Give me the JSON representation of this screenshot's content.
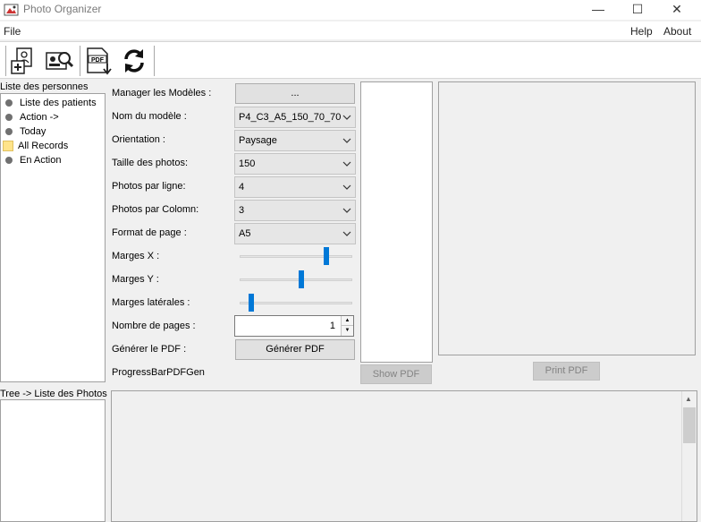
{
  "window": {
    "title": "Photo Organizer",
    "minimize_glyph": "—",
    "maximize_glyph": "☐",
    "close_glyph": "✕"
  },
  "menu": {
    "file": "File",
    "help": "Help",
    "about": "About"
  },
  "toolbar": {
    "buttons": [
      {
        "name": "add-record-icon"
      },
      {
        "name": "search-record-icon"
      },
      {
        "name": "pdf-export-icon",
        "label": "PDF"
      },
      {
        "name": "refresh-icon"
      }
    ]
  },
  "left_panel": {
    "persons_title": "Liste des personnes",
    "tree_items": [
      {
        "label": "Liste des patients",
        "icon": "bullet"
      },
      {
        "label": "Action  ->",
        "icon": "bullet"
      },
      {
        "label": "Today",
        "icon": "bullet"
      },
      {
        "label": "All Records",
        "icon": "folder"
      },
      {
        "label": "En Action",
        "icon": "bullet"
      }
    ],
    "photos_title": "Tree -> Liste des Photos"
  },
  "form": {
    "manager_label": "Manager les Modèles :",
    "manager_button": "...",
    "model_label": "Nom du modèle :",
    "model_value": "P4_C3_A5_150_70_70",
    "orientation_label": "Orientation :",
    "orientation_value": "Paysage",
    "photo_size_label": "Taille des photos:",
    "photo_size_value": "150",
    "per_line_label": "Photos par ligne:",
    "per_line_value": "4",
    "per_column_label": "Photos par Colomn:",
    "per_column_value": "3",
    "page_format_label": "Format de page :",
    "page_format_value": "A5",
    "margin_x_label": "Marges X :",
    "margin_x_level": 0.78,
    "margin_y_label": "Marges Y :",
    "margin_y_level": 0.55,
    "margin_side_label": "Marges latérales :",
    "margin_side_level": 0.08,
    "pages_label": "Nombre de pages :",
    "pages_value": "1",
    "generate_label": "Générer le PDF :",
    "generate_button": "Générer PDF",
    "progress_label": "ProgressBarPDFGen"
  },
  "preview": {
    "show_pdf_button": "Show PDF",
    "print_pdf_button": "Print PDF"
  },
  "colors": {
    "accent": "#0078d7",
    "folder": "#ffe48a"
  }
}
